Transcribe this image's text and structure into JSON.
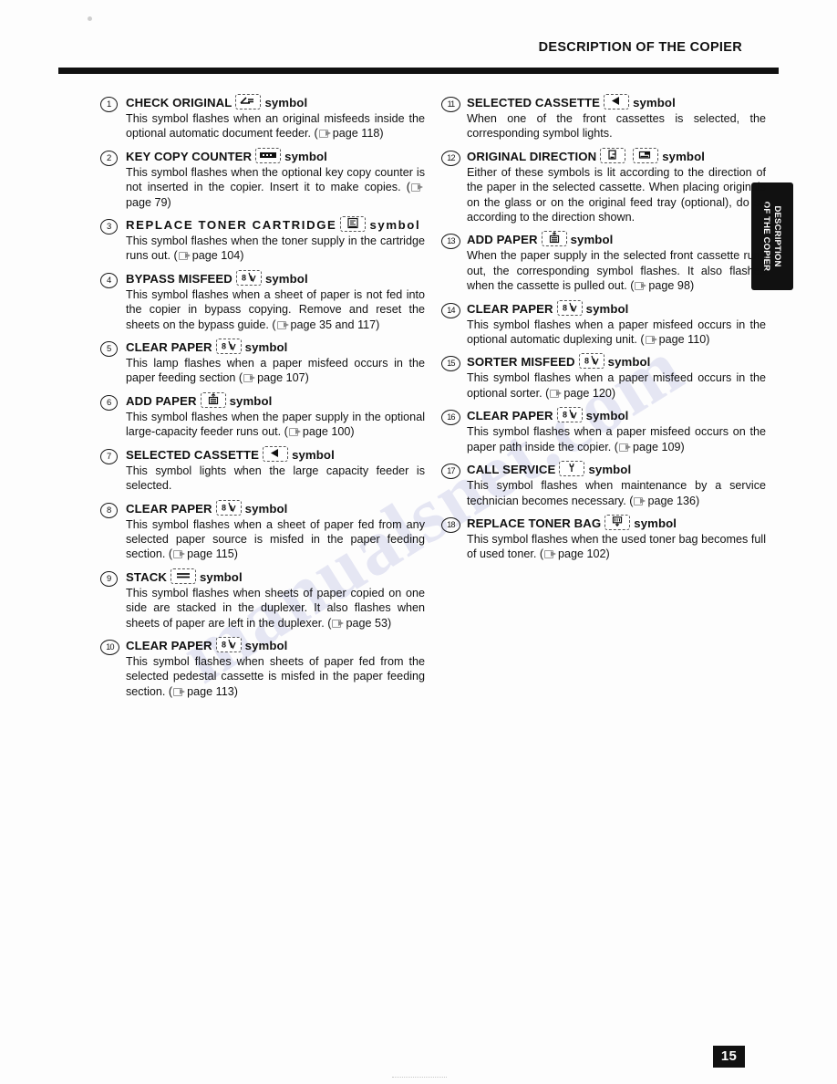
{
  "header": {
    "title": "DESCRIPTION OF THE COPIER"
  },
  "side_tab": {
    "line1": "DESCRIPTION",
    "line2": "OF THE COPIER"
  },
  "page_number": "15",
  "watermark": "manualsnet.com",
  "columns": {
    "left": [
      {
        "num": "1",
        "title": "CHECK ORIGINAL",
        "symbol": "check-original-symbol",
        "suffix": "symbol",
        "body": "This symbol flashes when an original misfeeds inside the optional automatic document feeder. (",
        "page_ref": "page 118)"
      },
      {
        "num": "2",
        "title": "KEY COPY COUNTER",
        "symbol": "key-copy-counter-symbol",
        "suffix": "symbol",
        "body": "This symbol flashes when the optional key copy counter is not inserted in the copier. Insert it to make copies. (",
        "page_ref": "page 79)"
      },
      {
        "num": "3",
        "title": "REPLACE  TONER  CARTRIDGE",
        "symbol": "replace-toner-cartridge-symbol",
        "suffix": "symbol",
        "title_wraps": true,
        "body": "This symbol flashes when the toner supply in the cartridge runs out. (",
        "page_ref": "page 104)"
      },
      {
        "num": "4",
        "title": "BYPASS MISFEED",
        "symbol": "misfeed-symbol",
        "suffix": "symbol",
        "body": "This symbol flashes when a sheet of paper is not fed into the copier in bypass copying. Remove and reset the sheets on the bypass guide. (",
        "page_ref": "page 35 and 117)"
      },
      {
        "num": "5",
        "title": "CLEAR PAPER",
        "symbol": "misfeed-symbol",
        "suffix": "symbol",
        "body": "This lamp flashes when a paper misfeed occurs in the paper feeding section (",
        "page_ref": "page 107)"
      },
      {
        "num": "6",
        "title": "ADD PAPER",
        "symbol": "add-paper-symbol",
        "suffix": "symbol",
        "body": "This symbol flashes when the paper supply in the optional large-capacity feeder runs out. (",
        "page_ref": "page 100)"
      },
      {
        "num": "7",
        "title": "SELECTED CASSETTE",
        "symbol": "selected-cassette-symbol",
        "suffix": "symbol",
        "body": "This symbol lights when the large capacity feeder is selected.",
        "page_ref": ""
      },
      {
        "num": "8",
        "title": "CLEAR PAPER",
        "symbol": "misfeed-symbol",
        "suffix": "symbol",
        "body": "This symbol flashes when a sheet of paper fed from any selected paper source is misfed in the paper feeding section. (",
        "page_ref": "page 115)"
      },
      {
        "num": "9",
        "title": "STACK",
        "symbol": "stack-symbol",
        "suffix": "symbol",
        "body": "This symbol flashes when sheets of paper copied on one side are stacked in the duplexer. It also flashes when sheets of paper are left in the duplexer. (",
        "page_ref": "page 53)"
      },
      {
        "num": "10",
        "title": "CLEAR PAPER",
        "symbol": "misfeed-symbol",
        "suffix": "symbol",
        "body": "This symbol flashes when sheets of paper fed from the selected pedestal cassette is misfed in the paper feeding section. (",
        "page_ref": "page 113)"
      }
    ],
    "right": [
      {
        "num": "11",
        "title": "SELECTED CASSETTE",
        "symbol": "selected-cassette-symbol",
        "suffix": "symbol",
        "body": "When one of the front cassettes is selected, the corresponding symbol lights.",
        "page_ref": ""
      },
      {
        "num": "12",
        "title": "ORIGINAL DIRECTION",
        "symbol": "original-direction-portrait-symbol",
        "symbol2": "original-direction-landscape-symbol",
        "suffix": "symbol",
        "body": "Either of these symbols is lit according to the direction of the paper in the selected cassette. When placing originals on the glass or on the original feed tray (optional), do so according to the direction shown.",
        "page_ref": ""
      },
      {
        "num": "13",
        "title": "ADD PAPER",
        "symbol": "add-paper-symbol",
        "suffix": "symbol",
        "body": "When the paper supply in the selected front cassette runs out, the corresponding symbol flashes. It also flashes when the cassette is pulled out. (",
        "page_ref": "page 98)"
      },
      {
        "num": "14",
        "title": "CLEAR PAPER",
        "symbol": "misfeed-symbol",
        "suffix": "symbol",
        "body": "This symbol flashes when a paper misfeed occurs in the optional automatic duplexing unit. (",
        "page_ref": "page 110)"
      },
      {
        "num": "15",
        "title": "SORTER MISFEED",
        "symbol": "misfeed-symbol",
        "suffix": "symbol",
        "body": "This symbol flashes when a paper misfeed occurs in the optional sorter. (",
        "page_ref": "page 120)"
      },
      {
        "num": "16",
        "title": "CLEAR PAPER",
        "symbol": "misfeed-symbol",
        "suffix": "symbol",
        "body": "This symbol flashes when a paper misfeed occurs on the paper path inside the copier. (",
        "page_ref": "page 109)"
      },
      {
        "num": "17",
        "title": "CALL SERVICE",
        "symbol": "call-service-symbol",
        "suffix": "symbol",
        "body": "This symbol flashes when maintenance by a service technician becomes necessary. (",
        "page_ref": "page 136)"
      },
      {
        "num": "18",
        "title": "REPLACE TONER BAG",
        "symbol": "replace-toner-bag-symbol",
        "suffix": "symbol",
        "body": "This symbol flashes when the used toner bag becomes full of used toner. (",
        "page_ref": "page 102)"
      }
    ]
  }
}
